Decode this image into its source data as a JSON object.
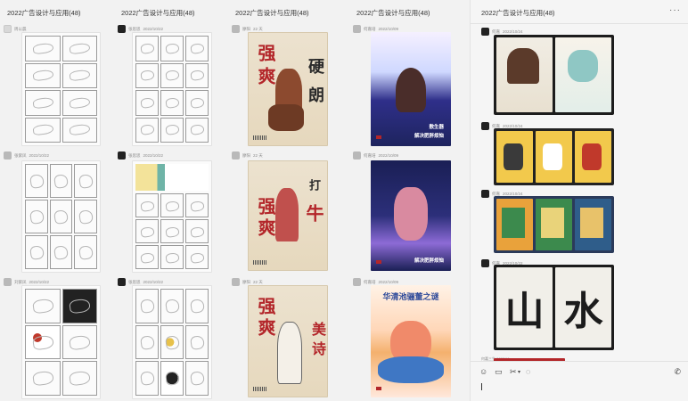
{
  "columns": [
    {
      "title": "2022广告设计与应用(48)",
      "posts": [
        {
          "author": "周以晨",
          "date": ""
        },
        {
          "author": "张紫凤",
          "date": "2022/10/22"
        },
        {
          "author": "刘紫凤",
          "date": "2022/10/22"
        }
      ]
    },
    {
      "title": "2022广告设计与应用(48)",
      "posts": [
        {
          "author": "张思思",
          "date": "2022/10/22"
        },
        {
          "author": "张思思",
          "date": "2022/10/22"
        },
        {
          "author": "张思思",
          "date": "2022/10/22"
        }
      ]
    },
    {
      "title": "2022广告设计与应用(48)",
      "posts": [
        {
          "author": "廖阳",
          "date": "22 天"
        },
        {
          "author": "廖阳",
          "date": "22 天"
        },
        {
          "author": "廖阳",
          "date": "22 天"
        }
      ]
    },
    {
      "title": "2022广告设计与应用(48)",
      "posts": [
        {
          "author": "何嘉培",
          "date": "2022/10/09"
        },
        {
          "author": "何嘉培",
          "date": "2022/10/09"
        },
        {
          "author": "何嘉培",
          "date": "2022/10/09"
        }
      ]
    }
  ],
  "posters": {
    "p1": {
      "a": "强",
      "b": "爽",
      "c": "硬",
      "d": "朗"
    },
    "p2": {
      "a": "强",
      "b": "爽",
      "c": "打",
      "d": "牛"
    },
    "p3": {
      "a": "强",
      "b": "爽",
      "c": "美",
      "d": "诗"
    },
    "blue1_sub": "敷生器",
    "blue1_cap": "解决肥胖烦恼",
    "blue2_cap": "解决肥胖烦恼",
    "orange_title": "华清池骊董之谜"
  },
  "panel": {
    "title": "2022广告设计与应用(48)",
    "posts": [
      {
        "author": "何嘉",
        "date": "2022/10/24"
      },
      {
        "author": "何嘉",
        "date": "2022/10/24"
      },
      {
        "author": "何嘉",
        "date": "2022/10/24"
      },
      {
        "author": "何嘉",
        "date": "2022/10/22"
      },
      {
        "author": "何嘉三生 2022/10",
        "date": ""
      }
    ],
    "shanshui": {
      "left": "山",
      "right": "水"
    }
  },
  "accent": {
    "red": "#b3262a",
    "navy": "#1e245e"
  }
}
